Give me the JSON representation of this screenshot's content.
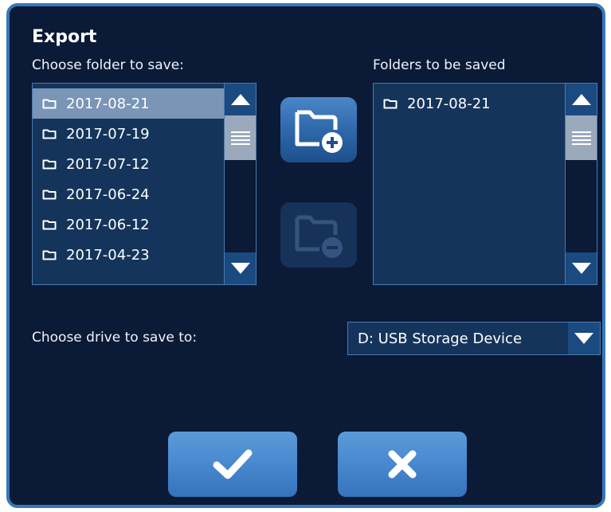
{
  "dialog": {
    "title": "Export"
  },
  "source": {
    "label": "Choose folder to save:",
    "selected_index": 0,
    "folders": [
      "2017-08-21",
      "2017-07-19",
      "2017-07-12",
      "2017-06-24",
      "2017-06-12",
      "2017-04-23"
    ]
  },
  "destination": {
    "label": "Folders to be saved",
    "folders": [
      "2017-08-21"
    ]
  },
  "drive": {
    "label": "Choose drive to save to:",
    "selected": "D: USB Storage Device"
  },
  "icons": {
    "folder": "folder-icon",
    "add": "folder-add-icon",
    "remove": "folder-remove-icon",
    "confirm": "checkmark-icon",
    "cancel": "close-icon"
  },
  "colors": {
    "background": "#0b1a36",
    "border": "#3a77b6",
    "list_bg": "#15345b",
    "selected_row": "#7a95b6",
    "button": "#4a8ad0"
  }
}
